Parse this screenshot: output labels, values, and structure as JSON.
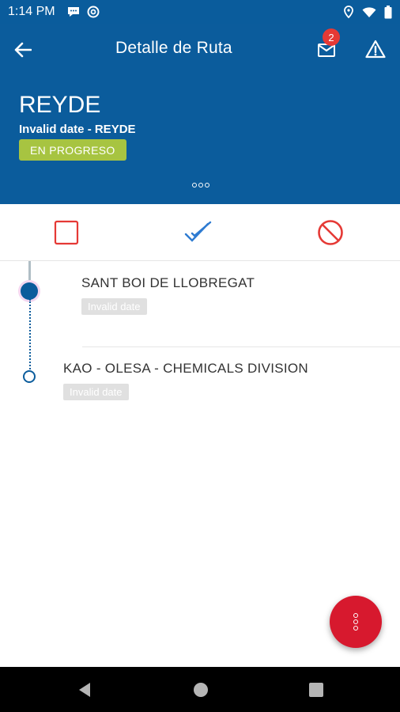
{
  "status_bar": {
    "time": "1:14 PM",
    "left_icons": [
      "chat-bubble-icon",
      "at-sign-icon"
    ],
    "right_icons": [
      "location-icon",
      "wifi-icon",
      "battery-icon"
    ]
  },
  "header": {
    "title": "Detalle de Ruta",
    "mail_badge_count": "2",
    "route_name": "REYDE",
    "route_subtitle": "Invalid date - REYDE",
    "status_label": "EN PROGRESO",
    "colors": {
      "header_bg": "#0b5c9c",
      "status_chip": "#a7c441"
    }
  },
  "filters": [
    {
      "name": "unchecked-filter",
      "icon": "square-outline-icon",
      "color": "#e53935"
    },
    {
      "name": "completed-filter",
      "icon": "double-check-icon",
      "color": "#2e7bd1"
    },
    {
      "name": "cancelled-filter",
      "icon": "block-icon",
      "color": "#e53935"
    }
  ],
  "stops": [
    {
      "name": "SANT BOI DE LLOBREGAT",
      "date": "Invalid date"
    },
    {
      "name": "KAO - OLESA - CHEMICALS DIVISION",
      "date": "Invalid date"
    }
  ],
  "fab": {
    "icon": "more-vertical-icon",
    "color": "#d7192e"
  },
  "nav": {
    "buttons": [
      "back-triangle-icon",
      "home-circle-icon",
      "recents-square-icon"
    ]
  }
}
